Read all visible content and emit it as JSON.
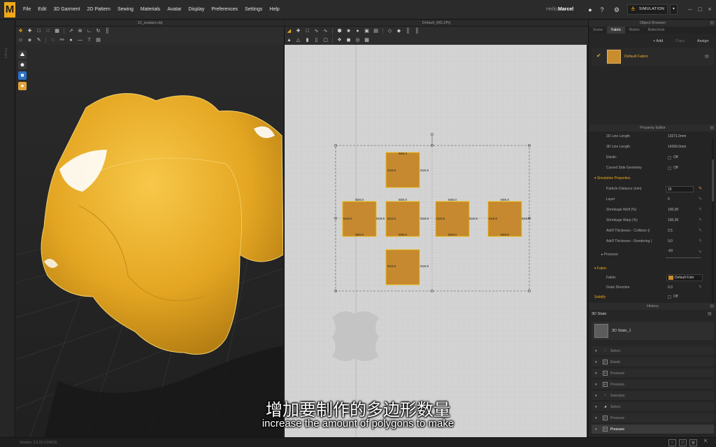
{
  "menubar": {
    "logo": "M",
    "items": [
      "File",
      "Edit",
      "3D Garment",
      "2D Pattern",
      "Sewing",
      "Materials",
      "Avatar",
      "Display",
      "Preferences",
      "Settings",
      "Help"
    ],
    "greeting": "Hello,",
    "user": "Marcel",
    "simulation_label": "SIMULATION"
  },
  "left_strip_label": "Library",
  "panels": {
    "view3d_title": "10_avatars.obj",
    "view2d_title": "Default_MD.ZPrj"
  },
  "pattern": {
    "pieces": [
      {
        "id": "top",
        "w": "508.0",
        "h": "518.6"
      },
      {
        "id": "left",
        "w": "508.0",
        "h": "518.6"
      },
      {
        "id": "center",
        "w": "508.0",
        "h": "518.6"
      },
      {
        "id": "right1",
        "w": "508.0",
        "h": "518.6"
      },
      {
        "id": "right2",
        "w": "508.0",
        "h": "518.6"
      },
      {
        "id": "bottom",
        "w": "508.0",
        "h": "518.6"
      }
    ]
  },
  "object_browser": {
    "title": "Object Browser",
    "tabs": [
      "Scene",
      "Fabric",
      "Button",
      "Buttonhole"
    ],
    "active_tab": "Fabric",
    "add_label": "+ Add",
    "copy_label": "Copy",
    "assign_label": "Assign",
    "fabric_name": "Default Fabric"
  },
  "property_editor": {
    "title": "Property Editor",
    "line_2d_label": "2D Line Length",
    "line_2d_value": "13271.0mm",
    "line_3d_label": "3D Line Length",
    "line_3d_value": "14266.0mm",
    "elastic_label": "Elastic",
    "elastic_value": "Off",
    "curved_label": "Curved Side Geometry",
    "curved_value": "Off",
    "sim_section": "Simulation Properties",
    "particle_label": "Particle Distance (mm)",
    "particle_value": "15",
    "layer_label": "Layer",
    "layer_value": "0",
    "weft_label": "Shrinkage Weft (%)",
    "weft_value": "100,00",
    "warp_label": "Shrinkage Warp (%)",
    "warp_value": "100,00",
    "thick_coll_label": "Add'l Thickness - Collision (r",
    "thick_coll_value": "2,5",
    "thick_rend_label": "Add'l Thickness - Rendering (",
    "thick_rend_value": "0,0",
    "pressure_label": "Pressure",
    "pressure_value": "-60",
    "fabric_section": "Fabric",
    "fabric_label": "Fabric",
    "fabric_value": "Default Fabr",
    "grain_label": "Grain Direction",
    "grain_value": "0,0",
    "solidify_section": "Solidify",
    "solidify_value": "Off"
  },
  "history": {
    "title": "History",
    "state_label": "3D State",
    "state_name": "3D State_1",
    "rows": [
      "Select",
      "Elastic",
      "Pressure",
      "Pressure",
      "Selection",
      "Select",
      "Pressure",
      "Pressure"
    ]
  },
  "status": {
    "version": "Version: 3.5.32    (r19423)"
  },
  "subtitles": {
    "cn": "增加要制作的多边形数量",
    "en": "increase the amount of polygons to make"
  }
}
